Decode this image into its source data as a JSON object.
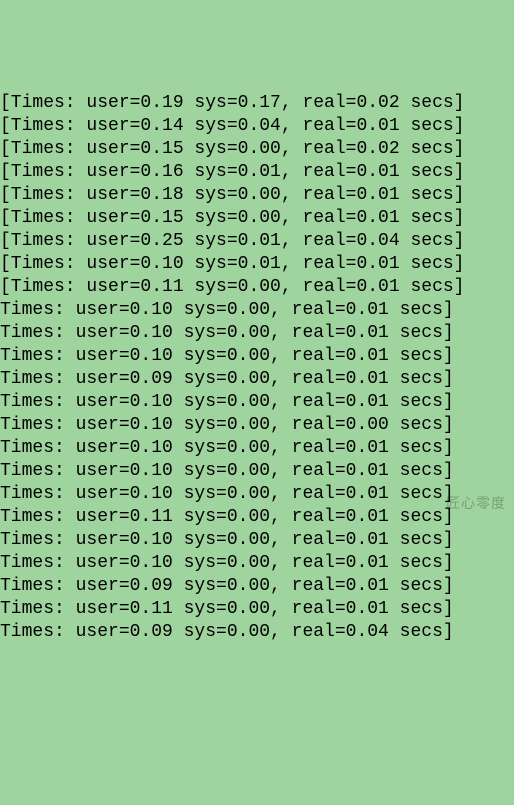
{
  "log_lines": [
    {
      "prefix": "[",
      "user": "0.19",
      "sys": "0.17",
      "real": "0.02",
      "suffix": "]"
    },
    {
      "prefix": "[",
      "user": "0.14",
      "sys": "0.04",
      "real": "0.01",
      "suffix": "]"
    },
    {
      "prefix": "[",
      "user": "0.15",
      "sys": "0.00",
      "real": "0.02",
      "suffix": "]"
    },
    {
      "prefix": "[",
      "user": "0.16",
      "sys": "0.01",
      "real": "0.01",
      "suffix": "]"
    },
    {
      "prefix": "[",
      "user": "0.18",
      "sys": "0.00",
      "real": "0.01",
      "suffix": "]"
    },
    {
      "prefix": "[",
      "user": "0.15",
      "sys": "0.00",
      "real": "0.01",
      "suffix": "]"
    },
    {
      "prefix": "[",
      "user": "0.25",
      "sys": "0.01",
      "real": "0.04",
      "suffix": "]"
    },
    {
      "prefix": "[",
      "user": "0.10",
      "sys": "0.01",
      "real": "0.01",
      "suffix": "]"
    },
    {
      "prefix": "[",
      "user": "0.11",
      "sys": "0.00",
      "real": "0.01",
      "suffix": "]"
    },
    {
      "prefix": "",
      "user": "0.10",
      "sys": "0.00",
      "real": "0.01",
      "suffix": "]"
    },
    {
      "prefix": "",
      "user": "0.10",
      "sys": "0.00",
      "real": "0.01",
      "suffix": "]"
    },
    {
      "prefix": "",
      "user": "0.10",
      "sys": "0.00",
      "real": "0.01",
      "suffix": "]"
    },
    {
      "prefix": "",
      "user": "0.09",
      "sys": "0.00",
      "real": "0.01",
      "suffix": "]"
    },
    {
      "prefix": "",
      "user": "0.10",
      "sys": "0.00",
      "real": "0.01",
      "suffix": "]"
    },
    {
      "prefix": "",
      "user": "0.10",
      "sys": "0.00",
      "real": "0.00",
      "suffix": "]"
    },
    {
      "prefix": "",
      "user": "0.10",
      "sys": "0.00",
      "real": "0.01",
      "suffix": "]"
    },
    {
      "prefix": "",
      "user": "0.10",
      "sys": "0.00",
      "real": "0.01",
      "suffix": "]"
    },
    {
      "prefix": "",
      "user": "0.10",
      "sys": "0.00",
      "real": "0.01",
      "suffix": "]"
    },
    {
      "prefix": "",
      "user": "0.11",
      "sys": "0.00",
      "real": "0.01",
      "suffix": "]"
    },
    {
      "prefix": "",
      "user": "0.10",
      "sys": "0.00",
      "real": "0.01",
      "suffix": "]"
    },
    {
      "prefix": "",
      "user": "0.10",
      "sys": "0.00",
      "real": "0.01",
      "suffix": "]"
    },
    {
      "prefix": "",
      "user": "0.09",
      "sys": "0.00",
      "real": "0.01",
      "suffix": "]"
    },
    {
      "prefix": "",
      "user": "0.11",
      "sys": "0.00",
      "real": "0.01",
      "suffix": "]"
    },
    {
      "prefix": "",
      "user": "0.09",
      "sys": "0.00",
      "real": "0.04",
      "suffix": "]"
    }
  ],
  "watermark_text": "匠心零度"
}
